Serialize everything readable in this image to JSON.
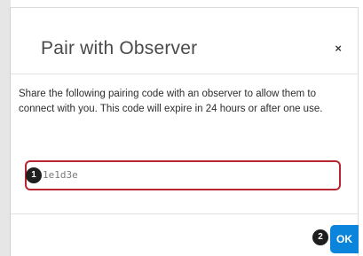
{
  "dialog": {
    "title": "Pair with Observer",
    "close_label": "×",
    "message": "Share the following pairing code with an observer to allow them to connect with you. This code will expire in 24 hours or after one use.",
    "pairing_code": "1e1d3e",
    "ok_label": "OK"
  },
  "annotations": {
    "step_1": "1",
    "step_2": "2"
  },
  "colors": {
    "accent": "#0b84dc",
    "highlight_border": "#b8242f"
  }
}
